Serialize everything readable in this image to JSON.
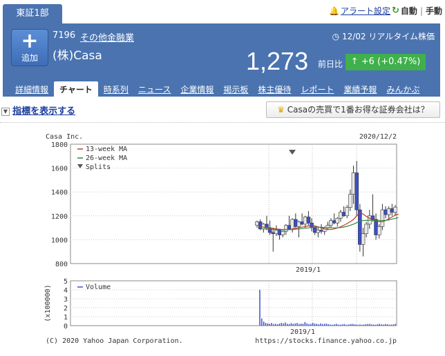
{
  "market_tab": "東証1部",
  "top_links": {
    "alert": "アラート設定",
    "auto": "自動",
    "manual": "手動",
    "separator": "|"
  },
  "stock": {
    "add_label": "追加",
    "code": "7196",
    "industry": "その他金融業",
    "name": "(株)Casa",
    "realtime": "12/02 リアルタイム株価",
    "price": "1,273",
    "change_label": "前日比",
    "change": "+6 (+0.47%)"
  },
  "nav_tabs": [
    "詳細情報",
    "チャート",
    "時系列",
    "ニュース",
    "企業情報",
    "掲示板",
    "株主優待",
    "レポート",
    "業績予報",
    "みんかぶ"
  ],
  "indicator_toggle": "指標を表示する",
  "promo": "Casaの売買で1番お得な証券会社は？",
  "chart_header": {
    "company": "Casa Inc.",
    "date": "2020/12/2"
  },
  "footer": {
    "copyright": "(C) 2020 Yahoo Japan Corporation.",
    "url": "https://stocks.finance.yahoo.co.jp"
  },
  "chart_data": [
    {
      "type": "candlestick",
      "yticks": [
        800,
        1000,
        1200,
        1400,
        1600,
        1800
      ],
      "ylim": [
        800,
        1800
      ],
      "xtick_label": "2019/1",
      "legend": [
        "13-week MA",
        "26-week MA",
        "Splits"
      ],
      "colors": {
        "up": "#e8e8e8",
        "down": "#3b4fc8",
        "ma13": "#c0392b",
        "ma26": "#2e8b3a"
      },
      "candles": [
        {
          "o": 1120,
          "h": 1160,
          "l": 1100,
          "c": 1150
        },
        {
          "o": 1150,
          "h": 1170,
          "l": 1080,
          "c": 1090
        },
        {
          "o": 1090,
          "h": 1140,
          "l": 1060,
          "c": 1130
        },
        {
          "o": 1130,
          "h": 1200,
          "l": 1080,
          "c": 1100
        },
        {
          "o": 1100,
          "h": 1160,
          "l": 1040,
          "c": 1060
        },
        {
          "o": 1060,
          "h": 1100,
          "l": 900,
          "c": 1050
        },
        {
          "o": 1050,
          "h": 1120,
          "l": 1030,
          "c": 1080
        },
        {
          "o": 1080,
          "h": 1090,
          "l": 1000,
          "c": 1040
        },
        {
          "o": 1040,
          "h": 1080,
          "l": 1020,
          "c": 1070
        },
        {
          "o": 1070,
          "h": 1130,
          "l": 1040,
          "c": 1120
        },
        {
          "o": 1120,
          "h": 1200,
          "l": 1080,
          "c": 1090
        },
        {
          "o": 1090,
          "h": 1180,
          "l": 1060,
          "c": 1170
        },
        {
          "o": 1170,
          "h": 1220,
          "l": 1100,
          "c": 1110
        },
        {
          "o": 1110,
          "h": 1160,
          "l": 1020,
          "c": 1150
        },
        {
          "o": 1150,
          "h": 1220,
          "l": 1120,
          "c": 1130
        },
        {
          "o": 1130,
          "h": 1200,
          "l": 1100,
          "c": 1190
        },
        {
          "o": 1190,
          "h": 1240,
          "l": 1120,
          "c": 1140
        },
        {
          "o": 1140,
          "h": 1180,
          "l": 1070,
          "c": 1100
        },
        {
          "o": 1100,
          "h": 1120,
          "l": 1040,
          "c": 1060
        },
        {
          "o": 1060,
          "h": 1100,
          "l": 1020,
          "c": 1080
        },
        {
          "o": 1080,
          "h": 1130,
          "l": 1050,
          "c": 1070
        },
        {
          "o": 1070,
          "h": 1110,
          "l": 1040,
          "c": 1100
        },
        {
          "o": 1100,
          "h": 1150,
          "l": 1080,
          "c": 1120
        },
        {
          "o": 1120,
          "h": 1180,
          "l": 1100,
          "c": 1160
        },
        {
          "o": 1160,
          "h": 1220,
          "l": 1130,
          "c": 1140
        },
        {
          "o": 1140,
          "h": 1190,
          "l": 1110,
          "c": 1180
        },
        {
          "o": 1180,
          "h": 1250,
          "l": 1150,
          "c": 1230
        },
        {
          "o": 1230,
          "h": 1280,
          "l": 1190,
          "c": 1200
        },
        {
          "o": 1200,
          "h": 1290,
          "l": 1180,
          "c": 1270
        },
        {
          "o": 1270,
          "h": 1420,
          "l": 1240,
          "c": 1380
        },
        {
          "o": 1380,
          "h": 1620,
          "l": 1300,
          "c": 1560
        },
        {
          "o": 1560,
          "h": 1660,
          "l": 1200,
          "c": 1250
        },
        {
          "o": 1250,
          "h": 1300,
          "l": 900,
          "c": 960
        },
        {
          "o": 960,
          "h": 1100,
          "l": 860,
          "c": 1050
        },
        {
          "o": 1050,
          "h": 1150,
          "l": 1020,
          "c": 1130
        },
        {
          "o": 1130,
          "h": 1250,
          "l": 1090,
          "c": 1200
        },
        {
          "o": 1200,
          "h": 1380,
          "l": 1150,
          "c": 1170
        },
        {
          "o": 1170,
          "h": 1220,
          "l": 1000,
          "c": 1040
        },
        {
          "o": 1040,
          "h": 1130,
          "l": 1010,
          "c": 1110
        },
        {
          "o": 1110,
          "h": 1300,
          "l": 1080,
          "c": 1250
        },
        {
          "o": 1250,
          "h": 1280,
          "l": 1180,
          "c": 1210
        },
        {
          "o": 1210,
          "h": 1280,
          "l": 1160,
          "c": 1260
        },
        {
          "o": 1260,
          "h": 1300,
          "l": 1200,
          "c": 1230
        },
        {
          "o": 1230,
          "h": 1290,
          "l": 1200,
          "c": 1273
        }
      ],
      "ma13": [
        1110,
        1105,
        1100,
        1098,
        1095,
        1090,
        1088,
        1085,
        1083,
        1085,
        1090,
        1095,
        1100,
        1105,
        1110,
        1115,
        1118,
        1115,
        1108,
        1098,
        1090,
        1085,
        1085,
        1090,
        1098,
        1108,
        1120,
        1135,
        1150,
        1170,
        1200,
        1225,
        1215,
        1195,
        1180,
        1165,
        1155,
        1150,
        1150,
        1160,
        1175,
        1190,
        1205,
        1215
      ],
      "ma26": [
        1090,
        1090,
        1089,
        1088,
        1087,
        1086,
        1085,
        1085,
        1084,
        1084,
        1085,
        1087,
        1090,
        1093,
        1096,
        1099,
        1102,
        1104,
        1105,
        1104,
        1102,
        1100,
        1099,
        1099,
        1100,
        1102,
        1106,
        1112,
        1120,
        1130,
        1142,
        1155,
        1160,
        1162,
        1163,
        1163,
        1162,
        1161,
        1160,
        1162,
        1166,
        1172,
        1178,
        1184
      ],
      "split_marker_value": 1730
    },
    {
      "type": "bar",
      "ylabel": "(x100000)",
      "yticks": [
        0,
        1,
        2,
        3,
        4,
        5
      ],
      "ylim": [
        0,
        5
      ],
      "xtick_label": "2019/1",
      "legend": [
        "Volume"
      ],
      "values": [
        4.0,
        0.8,
        0.45,
        0.3,
        0.25,
        0.2,
        0.3,
        0.18,
        0.2,
        0.15,
        0.22,
        0.3,
        0.25,
        0.35,
        0.2,
        0.18,
        0.28,
        0.2,
        0.25,
        0.3,
        0.18,
        0.22,
        0.2,
        0.4,
        0.25,
        0.18,
        0.2,
        0.3,
        0.22,
        0.2,
        0.15,
        0.25,
        0.18,
        0.2,
        0.22,
        0.15,
        0.12,
        0.1,
        0.15,
        0.2,
        0.12,
        0.1,
        0.14,
        0.18,
        0.1,
        0.12,
        0.15,
        0.2,
        0.16,
        0.12,
        0.1,
        0.13,
        0.1,
        0.12,
        0.15,
        0.18,
        0.2,
        0.14,
        0.12,
        0.1,
        0.16,
        0.2,
        0.14,
        0.12,
        0.18,
        0.15,
        0.1,
        0.12,
        0.14,
        0.2
      ]
    }
  ]
}
